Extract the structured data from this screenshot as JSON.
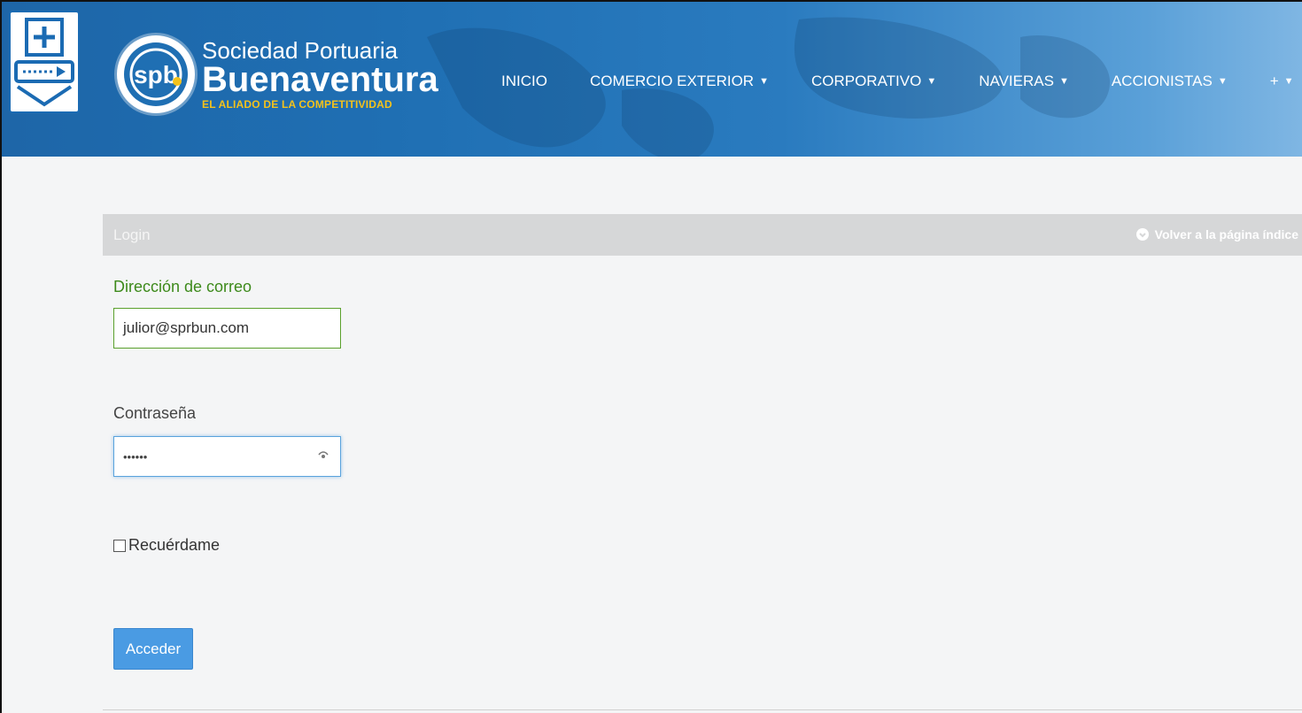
{
  "header": {
    "logo": {
      "monogram": "spb",
      "line1": "Sociedad Portuaria",
      "line2": "Buenaventura",
      "tagline": "EL ALIADO DE LA COMPETITIVIDAD"
    },
    "nav": [
      {
        "label": "INICIO",
        "dropdown": false
      },
      {
        "label": "COMERCIO EXTERIOR",
        "dropdown": true
      },
      {
        "label": "CORPORATIVO",
        "dropdown": true
      },
      {
        "label": "NAVIERAS",
        "dropdown": true
      },
      {
        "label": "ACCIONISTAS",
        "dropdown": true
      },
      {
        "label": "+",
        "dropdown": true
      }
    ]
  },
  "panel": {
    "title": "Login",
    "back_link": "Volver a la página índice"
  },
  "form": {
    "email_label": "Dirección de correo",
    "email_value": "julior@sprbun.com",
    "password_label": "Contraseña",
    "password_value": "••••••",
    "remember_label": "Recuérdame",
    "remember_checked": false,
    "submit_label": "Acceder"
  },
  "colors": {
    "header_blue": "#1f6fb3",
    "accent_green": "#3d8a1b",
    "button_blue": "#4a9be3",
    "logo_yellow": "#f4c21b"
  }
}
